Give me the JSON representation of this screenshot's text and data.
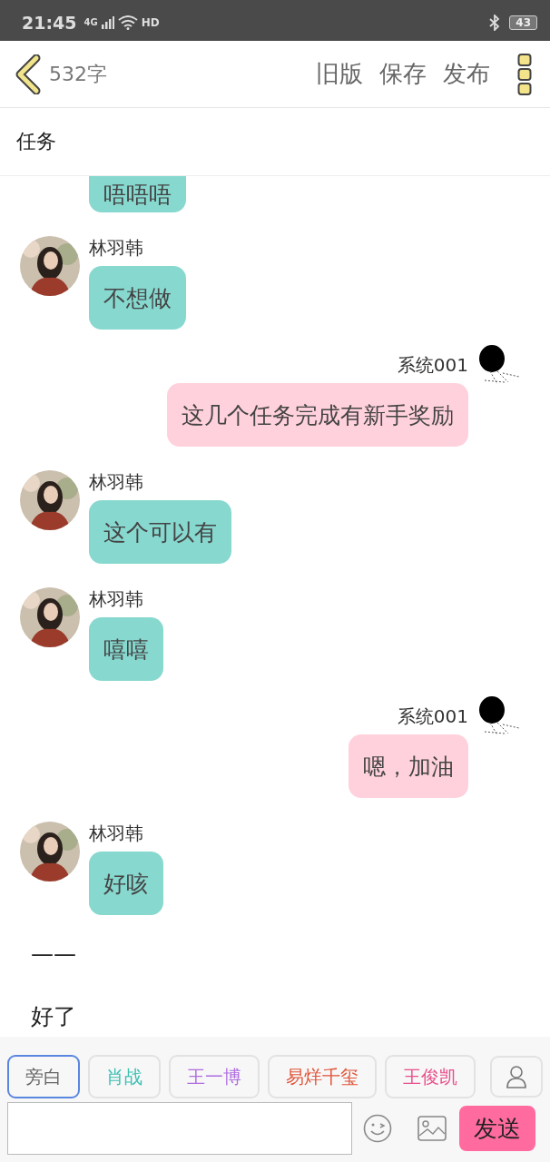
{
  "status_bar": {
    "time": "21:45",
    "network": "4G",
    "call_badge": "HD",
    "battery": "43"
  },
  "header": {
    "word_count": "532字",
    "actions": [
      "旧版",
      "保存",
      "发布"
    ]
  },
  "title": "任务",
  "messages": [
    {
      "kind": "left_tail",
      "text": "唔唔唔"
    },
    {
      "kind": "left",
      "name": "林羽韩",
      "text": "不想做"
    },
    {
      "kind": "right",
      "name": "系统001",
      "text": "这几个任务完成有新手奖励"
    },
    {
      "kind": "left",
      "name": "林羽韩",
      "text": "这个可以有"
    },
    {
      "kind": "left",
      "name": "林羽韩",
      "text": "嘻嘻"
    },
    {
      "kind": "right",
      "name": "系统001",
      "text": "嗯，加油"
    },
    {
      "kind": "left",
      "name": "林羽韩",
      "text": "好咳"
    },
    {
      "kind": "plain",
      "text": "——"
    },
    {
      "kind": "plain",
      "text": "好了"
    }
  ],
  "roles": [
    {
      "label": "旁白",
      "color": "#666666",
      "selected": true
    },
    {
      "label": "肖战",
      "color": "#3cbfb2",
      "selected": false
    },
    {
      "label": "王一博",
      "color": "#b06ee0",
      "selected": false
    },
    {
      "label": "易烊千玺",
      "color": "#e0553a",
      "selected": false
    },
    {
      "label": "王俊凯",
      "color": "#e8508c",
      "selected": false
    }
  ],
  "send_button": "发送"
}
